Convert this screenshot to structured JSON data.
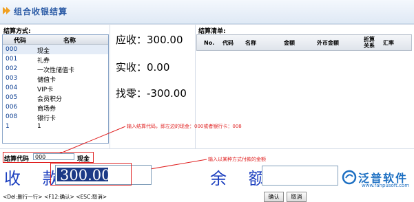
{
  "window": {
    "title": "组合收银结算"
  },
  "methods": {
    "label": "结算方式:",
    "col_code": "代码",
    "col_name": "名称",
    "rows": [
      {
        "code": "000",
        "name": "现金"
      },
      {
        "code": "001",
        "name": "礼券"
      },
      {
        "code": "002",
        "name": "一次性储值卡"
      },
      {
        "code": "003",
        "name": "储值卡"
      },
      {
        "code": "004",
        "name": "VIP卡"
      },
      {
        "code": "005",
        "name": "会员积分"
      },
      {
        "code": "006",
        "name": "商场券"
      },
      {
        "code": "008",
        "name": "银行卡"
      },
      {
        "code": "1",
        "name": "1"
      }
    ]
  },
  "summary": {
    "receivable": "应收：300.00",
    "received": "实收：0.00",
    "change": "找零：-300.00"
  },
  "settlement": {
    "label": "结算清单:",
    "cols": [
      "No.",
      "代码",
      "名称",
      "金额",
      "外币金额",
      "折算\n关系",
      "汇率"
    ]
  },
  "annotations": {
    "code_note": "输入结算代码，即左边的现金：000或者银行卡：008",
    "amount_note": "输入以某种方式付款的金额"
  },
  "input": {
    "code_label": "结算代码",
    "code_value": "000",
    "code_type": "现金",
    "amount_label": "收 款",
    "amount_value": "300.00",
    "change_label": "余 额",
    "change_value": ""
  },
  "footer": {
    "hint": "<Del:删行一行> <F12:确认> <ESC:取消>",
    "confirm": "确认",
    "cancel": "取消"
  },
  "brand": {
    "name": "泛普软件",
    "url": "www.fanpusoft.com",
    "color": "#1c6fc2"
  },
  "colors": {
    "accent": "#2a5aa5",
    "annotation": "#e02020",
    "selection": "#1c3a86"
  }
}
